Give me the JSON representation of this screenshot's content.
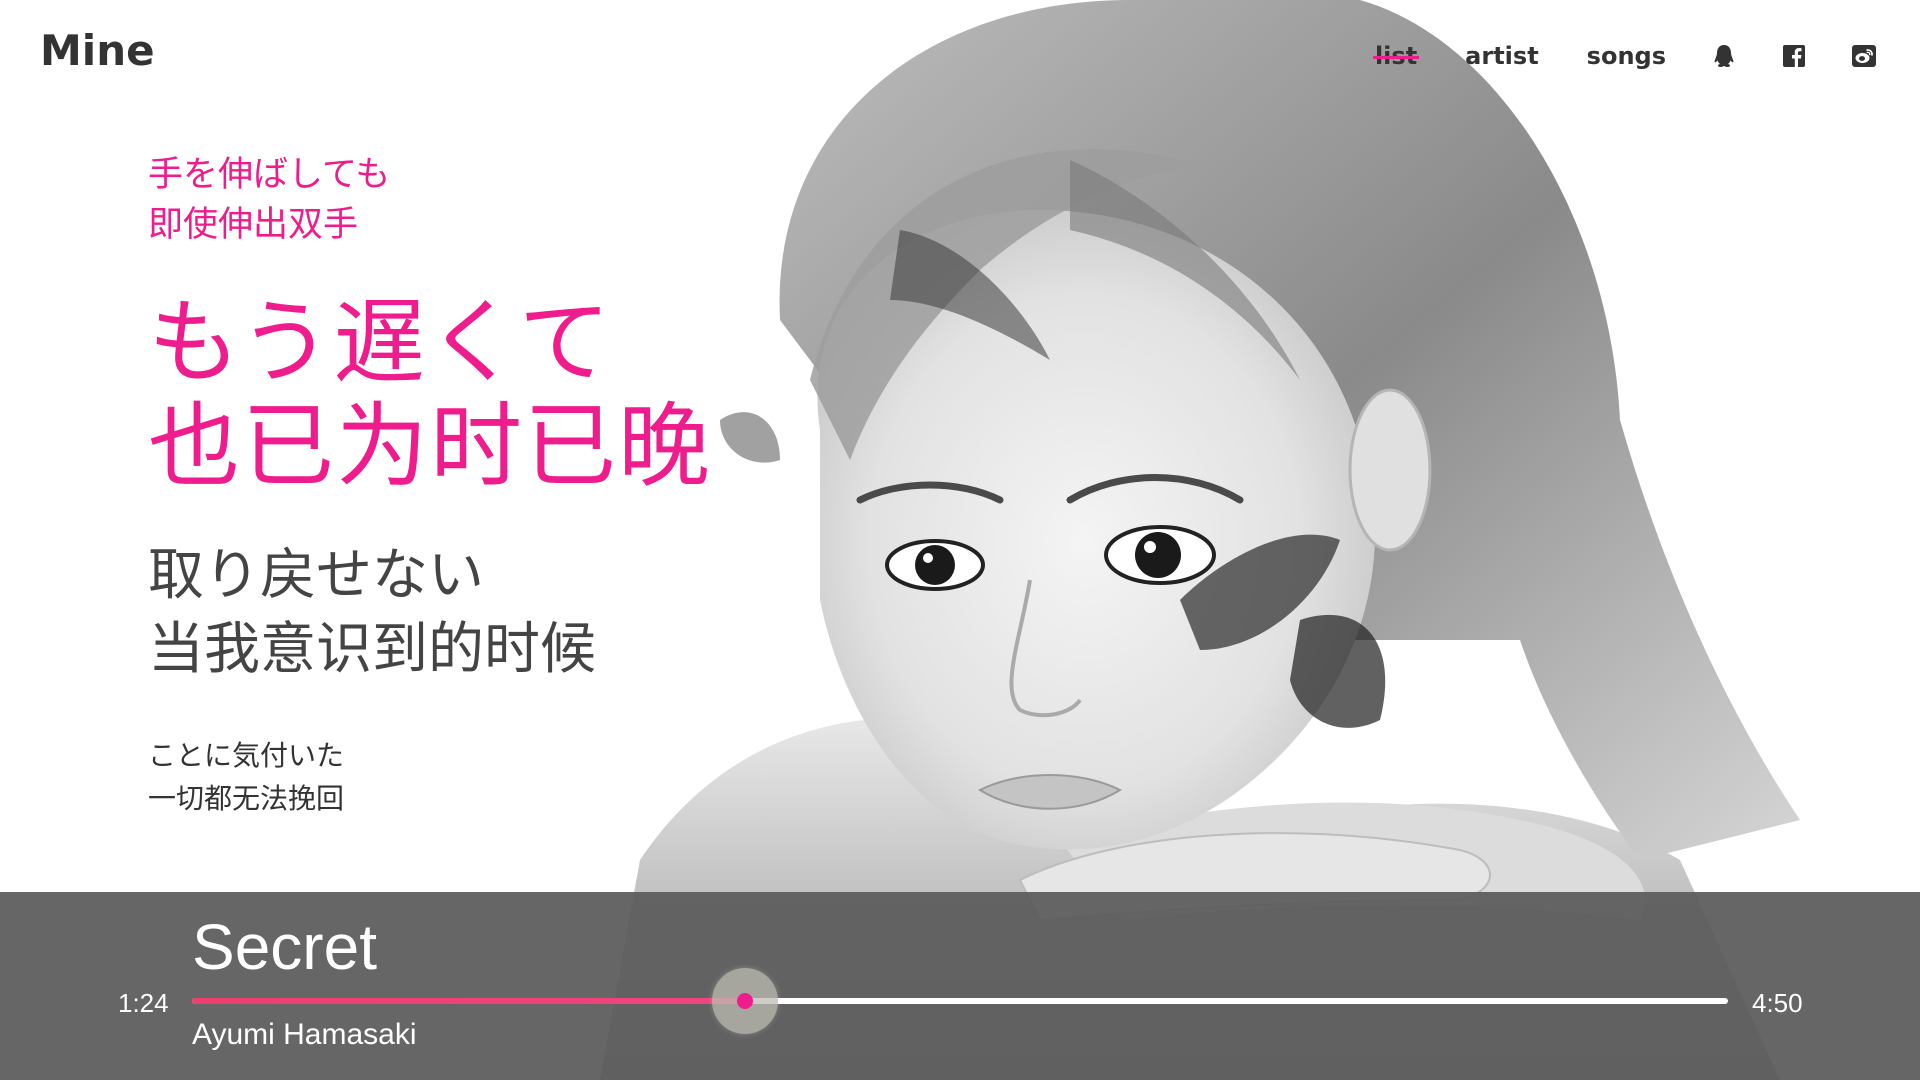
{
  "header": {
    "logo": "Mine",
    "nav": [
      {
        "label": "list",
        "state": "struck-through"
      },
      {
        "label": "artist"
      },
      {
        "label": "songs"
      }
    ],
    "social_icons": [
      "qq-icon",
      "facebook-icon",
      "weibo-icon"
    ]
  },
  "lyrics": {
    "previous": {
      "jp": "手を伸ばしても",
      "cn": "即使伸出双手"
    },
    "current": {
      "jp": "もう遅くて",
      "cn": "也已为时已晚"
    },
    "next": {
      "jp": "取り戻せない",
      "cn": "当我意识到的时候"
    },
    "after": {
      "jp": "ことに気付いた",
      "cn": "一切都无法挽回"
    }
  },
  "player": {
    "title": "Secret",
    "artist": "Ayumi Hamasaki",
    "time_current": "1:24",
    "time_total": "4:50",
    "progress": 0.36
  },
  "colors": {
    "accent": "#ee1c8c",
    "text_dark": "#333333",
    "player_bg": "#5c5c5c",
    "progress_fill": "#ee3f6e"
  }
}
